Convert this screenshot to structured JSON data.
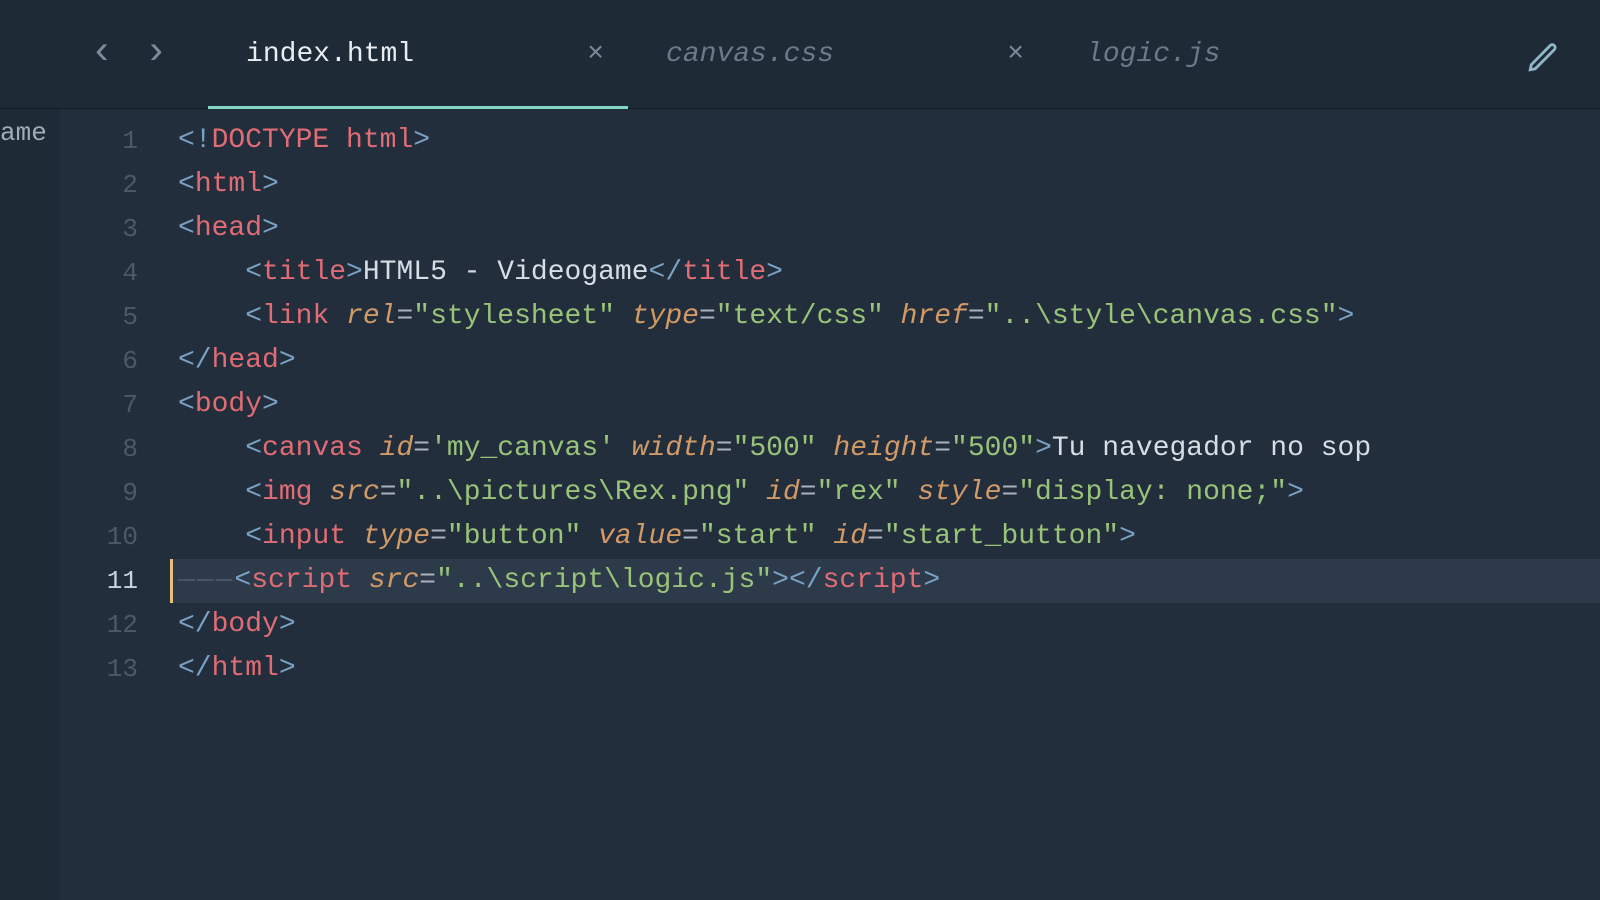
{
  "sidebar": {
    "fragment_label": "ame"
  },
  "tabbar": {
    "nav_back": "‹",
    "nav_forward": "›",
    "tabs": [
      {
        "label": "index.html",
        "active": true,
        "closeable": true
      },
      {
        "label": "canvas.css",
        "active": false,
        "closeable": true
      },
      {
        "label": "logic.js",
        "active": false,
        "closeable": false
      }
    ],
    "close_glyph": "×",
    "edit_icon": "pencil-icon"
  },
  "editor": {
    "current_line": 11,
    "lines": [
      {
        "n": 1,
        "indent": 0,
        "tokens": [
          {
            "t": "brkt",
            "v": "<!"
          },
          {
            "t": "tagn",
            "v": "DOCTYPE html"
          },
          {
            "t": "brkt",
            "v": ">"
          }
        ]
      },
      {
        "n": 2,
        "indent": 0,
        "tokens": [
          {
            "t": "brkt",
            "v": "<"
          },
          {
            "t": "tagn",
            "v": "html"
          },
          {
            "t": "brkt",
            "v": ">"
          }
        ]
      },
      {
        "n": 3,
        "indent": 0,
        "tokens": [
          {
            "t": "brkt",
            "v": "<"
          },
          {
            "t": "tagn",
            "v": "head"
          },
          {
            "t": "brkt",
            "v": ">"
          }
        ]
      },
      {
        "n": 4,
        "indent": 1,
        "tokens": [
          {
            "t": "brkt",
            "v": "<"
          },
          {
            "t": "tagn",
            "v": "title"
          },
          {
            "t": "brkt",
            "v": ">"
          },
          {
            "t": "txt",
            "v": "HTML5 - Videogame"
          },
          {
            "t": "brkt",
            "v": "</"
          },
          {
            "t": "tagn",
            "v": "title"
          },
          {
            "t": "brkt",
            "v": ">"
          }
        ]
      },
      {
        "n": 5,
        "indent": 1,
        "tokens": [
          {
            "t": "brkt",
            "v": "<"
          },
          {
            "t": "tagn",
            "v": "link"
          },
          {
            "t": "punc",
            "v": " "
          },
          {
            "t": "attr",
            "v": "rel"
          },
          {
            "t": "punc",
            "v": "="
          },
          {
            "t": "str",
            "v": "\"stylesheet\""
          },
          {
            "t": "punc",
            "v": " "
          },
          {
            "t": "attr",
            "v": "type"
          },
          {
            "t": "punc",
            "v": "="
          },
          {
            "t": "str",
            "v": "\"text/css\""
          },
          {
            "t": "punc",
            "v": " "
          },
          {
            "t": "attr",
            "v": "href"
          },
          {
            "t": "punc",
            "v": "="
          },
          {
            "t": "str",
            "v": "\"..\\style\\canvas.css\""
          },
          {
            "t": "brkt",
            "v": ">"
          }
        ]
      },
      {
        "n": 6,
        "indent": 0,
        "tokens": [
          {
            "t": "brkt",
            "v": "</"
          },
          {
            "t": "tagn",
            "v": "head"
          },
          {
            "t": "brkt",
            "v": ">"
          }
        ]
      },
      {
        "n": 7,
        "indent": 0,
        "tokens": [
          {
            "t": "brkt",
            "v": "<"
          },
          {
            "t": "tagn",
            "v": "body"
          },
          {
            "t": "brkt",
            "v": ">"
          }
        ]
      },
      {
        "n": 8,
        "indent": 1,
        "tokens": [
          {
            "t": "brkt",
            "v": "<"
          },
          {
            "t": "tagn",
            "v": "canvas"
          },
          {
            "t": "punc",
            "v": " "
          },
          {
            "t": "attr",
            "v": "id"
          },
          {
            "t": "punc",
            "v": "="
          },
          {
            "t": "str",
            "v": "'my_canvas'"
          },
          {
            "t": "punc",
            "v": " "
          },
          {
            "t": "attr",
            "v": "width"
          },
          {
            "t": "punc",
            "v": "="
          },
          {
            "t": "str",
            "v": "\"500\""
          },
          {
            "t": "punc",
            "v": " "
          },
          {
            "t": "attr",
            "v": "height"
          },
          {
            "t": "punc",
            "v": "="
          },
          {
            "t": "str",
            "v": "\"500\""
          },
          {
            "t": "brkt",
            "v": ">"
          },
          {
            "t": "txt",
            "v": "Tu navegador no sop"
          }
        ]
      },
      {
        "n": 9,
        "indent": 1,
        "tokens": [
          {
            "t": "brkt",
            "v": "<"
          },
          {
            "t": "tagn",
            "v": "img"
          },
          {
            "t": "punc",
            "v": " "
          },
          {
            "t": "attr",
            "v": "src"
          },
          {
            "t": "punc",
            "v": "="
          },
          {
            "t": "str",
            "v": "\"..\\pictures\\Rex.png\""
          },
          {
            "t": "punc",
            "v": " "
          },
          {
            "t": "attr",
            "v": "id"
          },
          {
            "t": "punc",
            "v": "="
          },
          {
            "t": "str",
            "v": "\"rex\""
          },
          {
            "t": "punc",
            "v": " "
          },
          {
            "t": "attr",
            "v": "style"
          },
          {
            "t": "punc",
            "v": "="
          },
          {
            "t": "str",
            "v": "\"display: none;\""
          },
          {
            "t": "brkt",
            "v": ">"
          }
        ]
      },
      {
        "n": 10,
        "indent": 1,
        "tokens": [
          {
            "t": "brkt",
            "v": "<"
          },
          {
            "t": "tagn",
            "v": "input"
          },
          {
            "t": "punc",
            "v": " "
          },
          {
            "t": "attr",
            "v": "type"
          },
          {
            "t": "punc",
            "v": "="
          },
          {
            "t": "str",
            "v": "\"button\""
          },
          {
            "t": "punc",
            "v": " "
          },
          {
            "t": "attr",
            "v": "value"
          },
          {
            "t": "punc",
            "v": "="
          },
          {
            "t": "str",
            "v": "\"start\""
          },
          {
            "t": "punc",
            "v": " "
          },
          {
            "t": "attr",
            "v": "id"
          },
          {
            "t": "punc",
            "v": "="
          },
          {
            "t": "str",
            "v": "\"start_button\""
          },
          {
            "t": "brkt",
            "v": ">"
          }
        ]
      },
      {
        "n": 11,
        "indent": 1,
        "indent_style": "dots",
        "tokens": [
          {
            "t": "brkt",
            "v": "<"
          },
          {
            "t": "tagn",
            "v": "script"
          },
          {
            "t": "punc",
            "v": " "
          },
          {
            "t": "attr",
            "v": "src"
          },
          {
            "t": "punc",
            "v": "="
          },
          {
            "t": "str",
            "v": "\"..\\script\\logic.js\""
          },
          {
            "t": "brkt",
            "v": ">"
          },
          {
            "t": "brkt",
            "v": "</"
          },
          {
            "t": "tagn",
            "v": "script"
          },
          {
            "t": "brkt",
            "v": ">"
          }
        ]
      },
      {
        "n": 12,
        "indent": 0,
        "tokens": [
          {
            "t": "brkt",
            "v": "</"
          },
          {
            "t": "tagn",
            "v": "body"
          },
          {
            "t": "brkt",
            "v": ">"
          }
        ]
      },
      {
        "n": 13,
        "indent": 0,
        "tokens": [
          {
            "t": "brkt",
            "v": "</"
          },
          {
            "t": "tagn",
            "v": "html"
          },
          {
            "t": "brkt",
            "v": ">"
          }
        ]
      }
    ]
  }
}
